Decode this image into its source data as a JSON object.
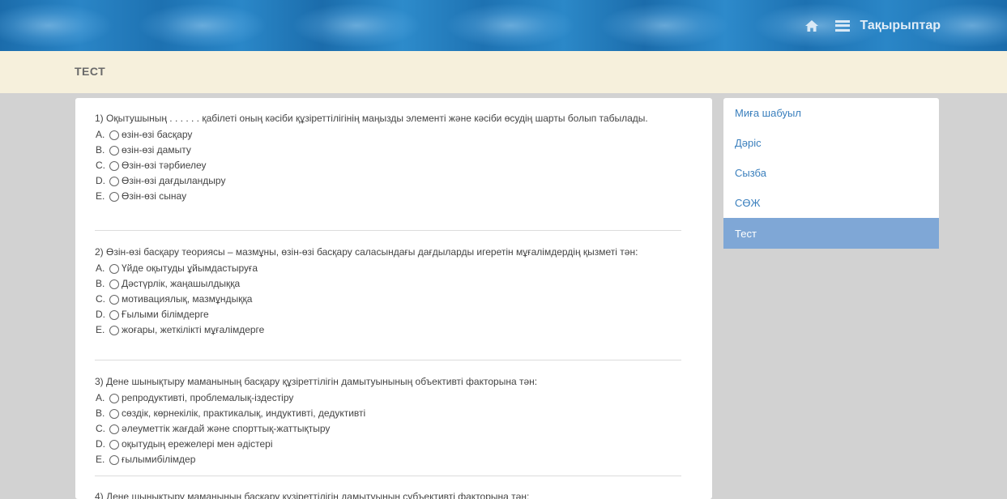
{
  "nav": {
    "home_icon": "home-icon",
    "menu_icon": "hamburger-icon",
    "topics_label": "Тақырыптар"
  },
  "page": {
    "title": "ТЕСТ"
  },
  "questions": [
    {
      "text": "1) Оқытушының . . . . . . қабілеті оның кәсіби құзіреттілігінің маңызды элементі және кәсіби өсудің шарты болып табылады.",
      "options": [
        {
          "letter": "A.",
          "text": "өзін-өзі басқару"
        },
        {
          "letter": "B.",
          "text": "өзін-өзі дамыту"
        },
        {
          "letter": "C.",
          "text": "Өзін-өзі тәрбиелеу"
        },
        {
          "letter": "D.",
          "text": "Өзін-өзі дағдыландыру"
        },
        {
          "letter": "E.",
          "text": "Өзін-өзі сынау"
        }
      ]
    },
    {
      "text": "2) Өзін-өзі басқару теориясы – мазмұны, өзін-өзі басқару саласындағы дағдыларды игеретін мұғалімдердің қызметі тән:",
      "options": [
        {
          "letter": "A.",
          "text": "Үйде оқытуды ұйымдастыруға"
        },
        {
          "letter": "B.",
          "text": "Дәстүрлік, жаңашылдыққа"
        },
        {
          "letter": "C.",
          "text": "мотивациялық, мазмұндыққа"
        },
        {
          "letter": "D.",
          "text": "Ғылыми білімдерге"
        },
        {
          "letter": "E.",
          "text": "жоғары, жеткілікті мұғалімдерге"
        }
      ]
    },
    {
      "text": "3) Дене шынықтыру маманының басқару құзіреттілігін дамытуынының объективті факторына тән:",
      "options": [
        {
          "letter": "A.",
          "text": "репродуктивті, проблемалық-іздестіру"
        },
        {
          "letter": "B.",
          "text": "сөздік, көрнекілік, практикалық, индуктивті, дедуктивті"
        },
        {
          "letter": "C.",
          "text": "әлеуметтік жағдай және спорттық-жаттықтыру"
        },
        {
          "letter": "D.",
          "text": "оқытудың ережелері мен әдістері"
        },
        {
          "letter": "E.",
          "text": "ғылымибілімдер"
        }
      ]
    },
    {
      "text": "4) Дене шынықтыру маманының басқару құзіреттілігін дамытуынын субъективті факторына тән:",
      "options": []
    }
  ],
  "sidebar": {
    "items": [
      {
        "label": "Миға шабуыл",
        "active": false
      },
      {
        "label": "Дәріс",
        "active": false
      },
      {
        "label": "Сызба",
        "active": false
      },
      {
        "label": "СӨЖ",
        "active": false
      },
      {
        "label": "Тест",
        "active": true
      }
    ]
  }
}
